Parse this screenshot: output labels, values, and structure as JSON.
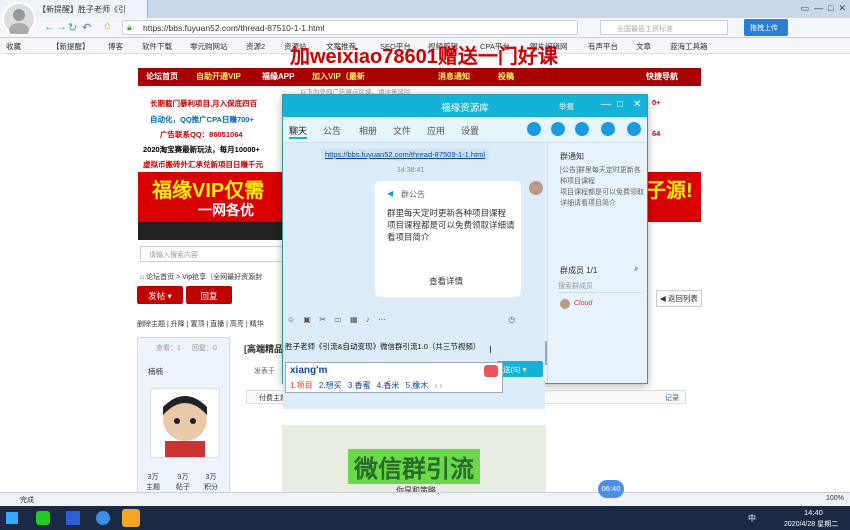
{
  "browser": {
    "tab_title": "【新提醒】胜子老师《引",
    "url": "https://bbs.fuyuan52.com/thread-87510-1-1.html",
    "search_placeholder": "全国最低工资标准",
    "upload_label": "拖拽上传"
  },
  "bookmarks": [
    "收藏",
    "【新提醒】",
    "博客",
    "软件下载",
    "零元购网站",
    "资源2",
    "资源站",
    "文案推荐",
    "SEO平台",
    "视频剪辑",
    "CPA平台",
    "图片编辑网",
    "有声平台",
    "文章",
    "蓝海工具箱"
  ],
  "site": {
    "nav": [
      "论坛首页",
      "自助开通VIP",
      "福缘APP",
      "加入VIP（最新",
      "消息通知",
      "投稿",
      "快捷导航"
    ],
    "watermark": "加weixiao78601赠送一门好课",
    "ads_left": [
      "长期截门暴利项目,月入保底四百",
      "自动化，QQ推广CPA日赚700+",
      "广告联系QQ：86051064",
      "2020淘宝赛最新玩法，每月10000+",
      "虚拟币搬砖外汇承兑新项目日赚千元"
    ],
    "ads_right": [
      "0+",
      "64",
      "子源!"
    ],
    "top_note": "以下为外部广告展示区域，请注意风险",
    "banner": "福缘VIP仅需",
    "banner_sub": "一网各优",
    "search_placeholder": "请输入搜索内容",
    "breadcrumb": [
      "论坛首页",
      "Vip抢享（全网最好资源封"
    ],
    "post_button": "发帖",
    "reply_button": "回复",
    "back_list": "返回列表",
    "toolbar": [
      "删除主题",
      "升降",
      "置顶",
      "直播",
      "高亮",
      "精华"
    ],
    "views_label": "查看：1",
    "replies_label": "回复：0",
    "thread_title": "[高端精品]",
    "poster": "楠楠",
    "posted": "发表于",
    "paid_note": "付费主题，价格：100 个福币",
    "record": "记录",
    "stats": [
      {
        "n": "3万",
        "l": "主题"
      },
      {
        "n": "3万",
        "l": "帖子"
      },
      {
        "n": "3万",
        "l": "积分"
      }
    ],
    "course_image_text": "微信群引流",
    "course_sub": "你是和策略"
  },
  "qq": {
    "title": "福缘资源库",
    "report": "举报",
    "tabs": [
      "聊天",
      "公告",
      "相册",
      "文件",
      "应用",
      "设置"
    ],
    "link": "https://bbs.fuyuan52.com/thread-87509-1-1.html",
    "time": "14:38:41",
    "notice_title": "群公告",
    "notice_body": "群里每天定时更新各种项目课程\n项目课程都是可以免费领取详细请看项目简介",
    "view_detail": "查看详情",
    "side_title": "群通知",
    "side_body": "[公告]群里每天定时更新各种项目课程\n项目课程都是可以免费领取详细请看项目简介",
    "members_label": "群成员 1/1",
    "member_search": "搜索群成员",
    "member_name": "Cloud",
    "input_text": "胜子老师《引流&自动变现》微信群引流1.0（共三节视频）",
    "send_label": "送(S)"
  },
  "ime": {
    "pinyin": "xiang'm",
    "candidates": [
      "1.项目",
      "2.想买",
      "3.香蜜",
      "4.香米",
      "5.橡木"
    ]
  },
  "status": {
    "done": "完成",
    "zoom": "100%",
    "badge": "06:40"
  },
  "taskbar": {
    "time": "14:40",
    "date": "2020/4/28 星期二",
    "lang": "中"
  }
}
